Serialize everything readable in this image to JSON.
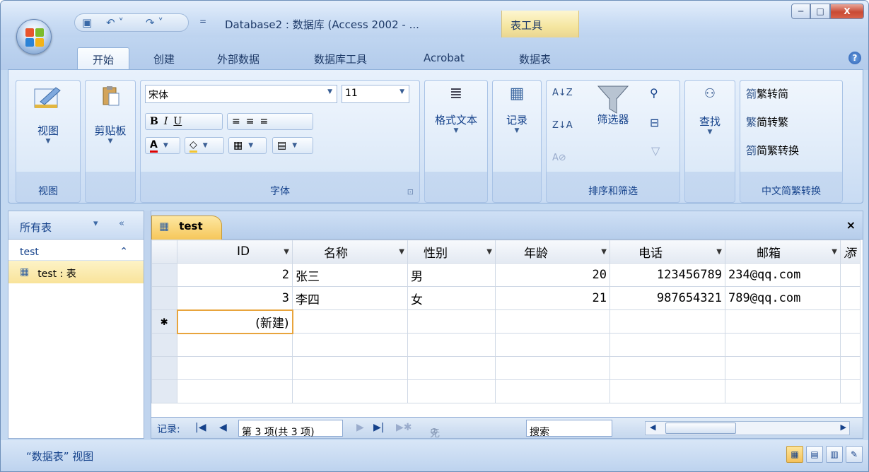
{
  "window": {
    "title": "Database2 : 数据库 (Access 2002 - ...",
    "context_tab": "表工具",
    "min": "─",
    "max": "□",
    "close": "X"
  },
  "qat": {
    "save": "▣",
    "undo": "↶ ˅",
    "redo": "↷ ˅",
    "more": "="
  },
  "tabs": [
    "开始",
    "创建",
    "外部数据",
    "数据库工具",
    "Acrobat",
    "数据表"
  ],
  "help": "?",
  "ribbon": {
    "view": {
      "label": "视图",
      "group": "视图"
    },
    "clipboard": {
      "label": "剪贴板"
    },
    "font": {
      "name": "宋体",
      "size": "11",
      "bold": "B",
      "italic": "I",
      "underline": "U",
      "font_color": "A",
      "group": "字体",
      "launcher": "⊡"
    },
    "rich_text": {
      "label": "格式文本"
    },
    "records": {
      "label": "记录"
    },
    "sort_filter": {
      "filter_label": "筛选器",
      "group": "排序和筛选"
    },
    "find": {
      "label": "查找"
    },
    "chinese_conv": {
      "to_simple": "繁转简",
      "to_traditional": "简转繁",
      "convert": "简繁转换",
      "group": "中文简繁转换"
    }
  },
  "nav": {
    "header": "所有表",
    "group": "test",
    "item": "test : 表"
  },
  "doc": {
    "tab": "test",
    "close": "×",
    "columns": [
      "ID",
      "名称",
      "性别",
      "年龄",
      "电话",
      "邮箱",
      "添"
    ],
    "rows": [
      {
        "id": "2",
        "name": "张三",
        "sex": "男",
        "age": "20",
        "phone": "123456789",
        "email": "234@qq.com"
      },
      {
        "id": "3",
        "name": "李四",
        "sex": "女",
        "age": "21",
        "phone": "987654321",
        "email": "789@qq.com"
      }
    ],
    "new_marker": "✱",
    "new_label": "(新建)"
  },
  "recordbar": {
    "label": "记录:",
    "first": "|◀",
    "prev": "◀",
    "position": "第 3 项(共 3 项)",
    "next": "▶",
    "last": "▶|",
    "new": "▶✱",
    "filter": "无筛选器",
    "search": "搜索"
  },
  "statusbar": {
    "text": "“数据表” 视图"
  }
}
